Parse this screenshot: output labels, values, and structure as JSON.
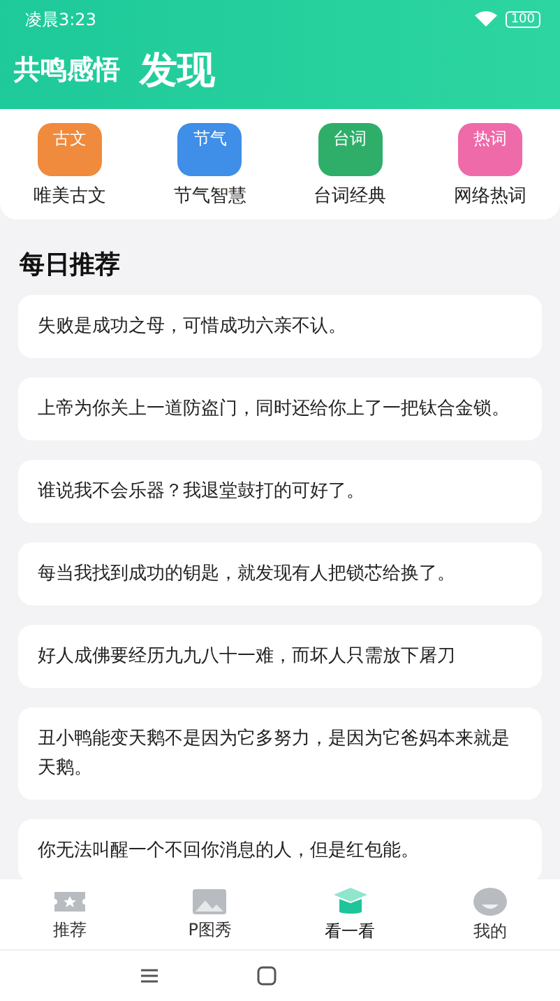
{
  "status_bar": {
    "time": "凌晨3:23",
    "battery": "100"
  },
  "header": {
    "app_name": "共鸣感悟",
    "title": "发现"
  },
  "categories": [
    {
      "badge": "古文",
      "label": "唯美古文",
      "color": "#f08a3c"
    },
    {
      "badge": "节气",
      "label": "节气智慧",
      "color": "#3f8ee8"
    },
    {
      "badge": "台词",
      "label": "台词经典",
      "color": "#2fae6a"
    },
    {
      "badge": "热词",
      "label": "网络热词",
      "color": "#ee6aa8"
    }
  ],
  "section_title": "每日推荐",
  "quotes": [
    "失败是成功之母，可惜成功六亲不认。",
    "上帝为你关上一道防盗门，同时还给你上了一把钛合金锁。",
    "谁说我不会乐器？我退堂鼓打的可好了。",
    "每当我找到成功的钥匙，就发现有人把锁芯给换了。",
    "好人成佛要经历九九八十一难，而坏人只需放下屠刀",
    "丑小鸭能变天鹅不是因为它多努力，是因为它爸妈本来就是天鹅。",
    "你无法叫醒一个不回你消息的人，但是红包能。"
  ],
  "tabs": [
    {
      "label": "推荐",
      "kind": "ticket",
      "selected": false
    },
    {
      "label": "P图秀",
      "kind": "image",
      "selected": false
    },
    {
      "label": "看一看",
      "kind": "cap",
      "selected": true
    },
    {
      "label": "我的",
      "kind": "face",
      "selected": false
    }
  ]
}
